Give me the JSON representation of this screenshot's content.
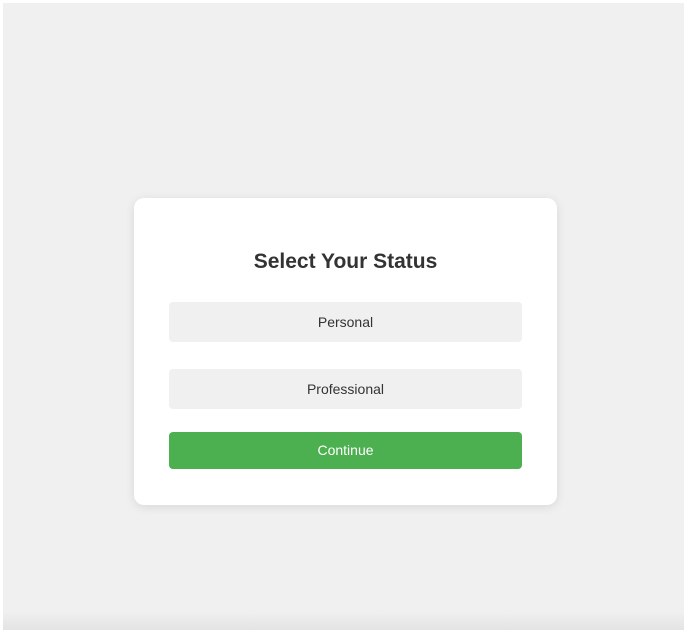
{
  "dialog": {
    "title": "Select Your Status",
    "options": [
      {
        "label": "Personal"
      },
      {
        "label": "Professional"
      }
    ],
    "continue_label": "Continue"
  },
  "colors": {
    "page_background": "#f0f0f0",
    "card_background": "#ffffff",
    "option_background": "#f0f0f0",
    "primary_button": "#4caf50",
    "text": "#333333"
  }
}
